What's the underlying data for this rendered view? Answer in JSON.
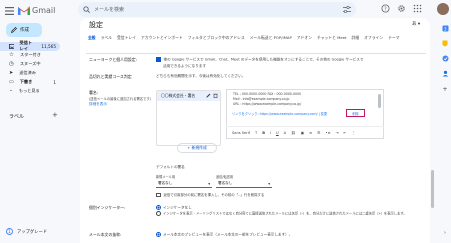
{
  "app": {
    "name": "Gmail"
  },
  "search": {
    "placeholder": "メールを検索"
  },
  "compose": {
    "label": "作成"
  },
  "nav": [
    {
      "label": "受信トレイ",
      "count": "11,565"
    },
    {
      "label": "スター付き",
      "count": ""
    },
    {
      "label": "スヌーズ中",
      "count": ""
    },
    {
      "label": "送信済み",
      "count": ""
    },
    {
      "label": "下書き",
      "count": "1"
    },
    {
      "label": "もっと見る",
      "count": ""
    }
  ],
  "labels_heading": "ラベル",
  "upgrade": "アップグレード",
  "settings": {
    "title": "設定",
    "lang": "あ ▾",
    "tabs": [
      "全般",
      "ラベル",
      "受信トレイ",
      "アカウントとインポート",
      "フィルタとブロック中のアドレス",
      "メール転送と POP/IMAP",
      "アドオン",
      "チャットと Meet",
      "詳細",
      "オフライン",
      "テーマ"
    ],
    "smart_label": "ニューヨークと個人用設定:",
    "smart_text1": "他の Google サービスで Gmail、Chat、Meet のデータを使用した機能をオンにすることで、その他の Google サービスで",
    "smart_text2": "活用できるようになります",
    "grammar_label": "品切れと実績コース判定",
    "grammar_text": "どちらも有効期間を示す、今後は有効化してください。",
    "signature_label": "署名:",
    "signature_sub": "(送信メールの最後に追加される署名です)",
    "signature_link": "詳細を表示",
    "signature_item": "〇〇株式会社・署名",
    "editor_lines": [
      "TEL : 000-0000-0000 FAX : 000-0000-0000",
      "Mail : info@example-company.co.jp",
      "URL : https://www.example-company.co.jp/"
    ],
    "link_line": "リンクをクリック: https://www.example-company.com/ | 変更",
    "selected_word": "削除",
    "toolbar_font": "Sans Serif",
    "toolbar_size": "T",
    "new_button": "+ 新規作成",
    "defaults_label": "デフォルトの署名",
    "new_mail_label": "新規メール用",
    "reply_label": "返信/転送用",
    "new_mail_select": "署名なし",
    "reply_select": "署名なし",
    "insert_text": "返信で引用部分の前に署名を挿入し、その前の「--」行を削除する",
    "personal_label": "個別インジケーター:",
    "personal_opt1": "インジケータなし",
    "personal_opt2": "インジケータを表示 - メーリングリストではなく自分宛てに直接送信されたメールには矢印（›）を、自分だけに送信されたメールには二重矢印（»）を表示します。",
    "snippet_label": "メール本文の抜粋:",
    "snippet_text": "メール本文のプレビューを表示（メール本文の一部をプレビュー表示します）。"
  },
  "colors": {
    "accent": "#0b57d0",
    "highlight_border": "#c2185b",
    "compose_bg": "#c2e7ff",
    "nav_active_bg": "#d3e3fd"
  }
}
